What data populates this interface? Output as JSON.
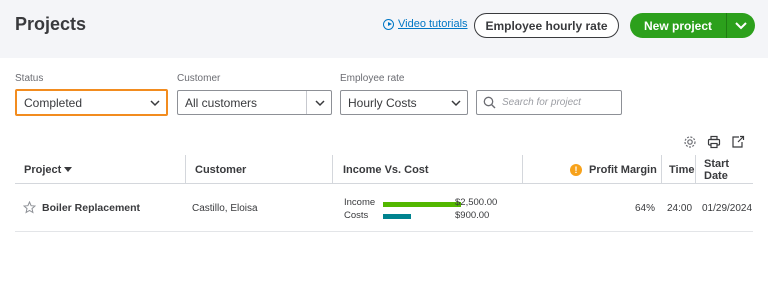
{
  "header": {
    "title": "Projects",
    "video_link": "Video tutorials",
    "employee_rate_button": "Employee hourly rate",
    "new_project_button": "New project"
  },
  "filters": {
    "status": {
      "label": "Status",
      "value": "Completed"
    },
    "customer": {
      "label": "Customer",
      "value": "All customers"
    },
    "employee_rate": {
      "label": "Employee rate",
      "value": "Hourly Costs"
    },
    "search": {
      "placeholder": "Search for project"
    }
  },
  "table": {
    "columns": {
      "project": "Project",
      "customer": "Customer",
      "income_vs_cost": "Income Vs. Cost",
      "profit_margin": "Profit Margin",
      "time": "Time",
      "start_date": "Start Date"
    },
    "rows": [
      {
        "project": "Boiler Replacement",
        "customer": "Castillo, Eloisa",
        "income_label": "Income",
        "income_value": "$2,500.00",
        "income_amount": 2500,
        "costs_label": "Costs",
        "costs_value": "$900.00",
        "costs_amount": 900,
        "profit_margin": "64%",
        "time": "24:00",
        "start_date": "01/29/2024"
      }
    ]
  },
  "colors": {
    "accent_green": "#2ca01c",
    "income_bar": "#53b700",
    "costs_bar": "#00838f",
    "focus_outline": "#f28c1f",
    "warning": "#f7a21b",
    "link": "#0077c5"
  },
  "icons": [
    "play-icon",
    "chevron-down-icon",
    "search-icon",
    "gear-icon",
    "printer-icon",
    "export-icon",
    "sort-desc-icon",
    "warning-icon",
    "star-icon"
  ]
}
